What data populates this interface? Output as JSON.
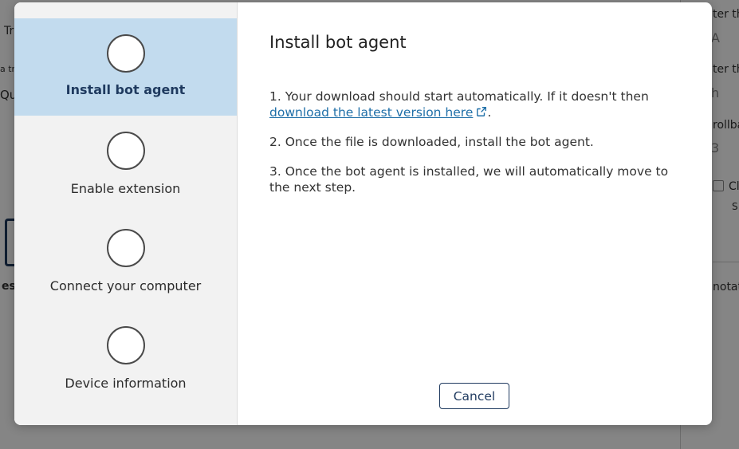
{
  "background": {
    "left_fragments": [
      "Tr",
      "a tr",
      "Qu",
      "es"
    ],
    "right_fragments": [
      "ter th",
      "A",
      "ter th",
      "h",
      "rollba",
      "3",
      "Cl",
      "S",
      "notat"
    ]
  },
  "steps": [
    {
      "label": "Install bot agent",
      "state": "active"
    },
    {
      "label": "Enable extension",
      "state": "pending"
    },
    {
      "label": "Connect your computer",
      "state": "pending"
    },
    {
      "label": "Device information",
      "state": "pending"
    }
  ],
  "content": {
    "title": "Install bot agent",
    "step1_text": "1. Your download should start automatically. If it doesn't then",
    "step1_link": "download the latest version here",
    "step1_suffix": ".",
    "step2_text": "2. Once the file is downloaded, install the bot agent.",
    "step3_text": "3. Once the bot agent is installed, we will automatically move to the next step."
  },
  "buttons": {
    "cancel": "Cancel"
  },
  "colors": {
    "active_step_bg": "#c2dbee",
    "accent": "#1f3a5f",
    "link": "#1f6fa8"
  }
}
